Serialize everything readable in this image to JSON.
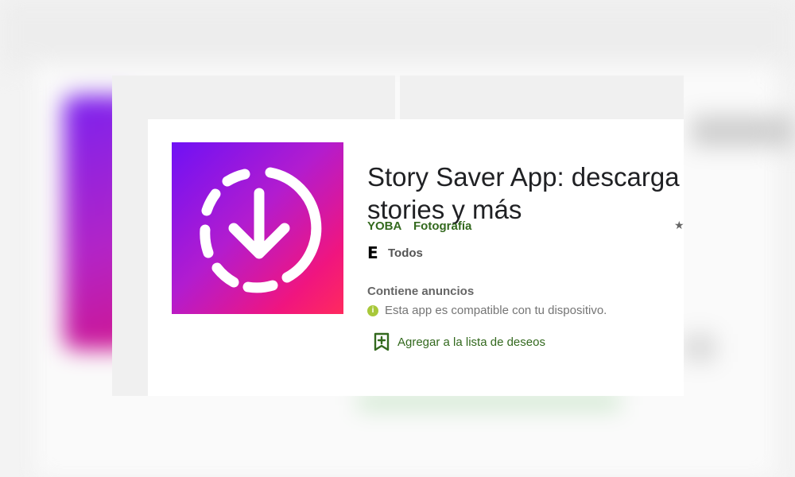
{
  "app": {
    "title_line1": "Story Saver App: descarga",
    "title_line2": "stories y más",
    "developer": "YOBA",
    "category": "Fotografía",
    "star_icon": "star-icon",
    "content_rating_icon": "esrb-e-icon",
    "content_rating_glyph": "E",
    "content_rating": "Todos",
    "ads_notice": "Contiene anuncios",
    "compat_icon": "info-icon",
    "compat_glyph": "i",
    "compatibility": "Esta app es compatible con tu dispositivo.",
    "wishlist_icon": "bookmark-add-icon",
    "wishlist_label": "Agregar a la lista de deseos"
  },
  "colors": {
    "green": "#33691e",
    "icon_gradient": [
      "#6f11f5",
      "#b21ccf",
      "#f0157f",
      "#ff2a5e"
    ],
    "info": "#a8c83a"
  }
}
